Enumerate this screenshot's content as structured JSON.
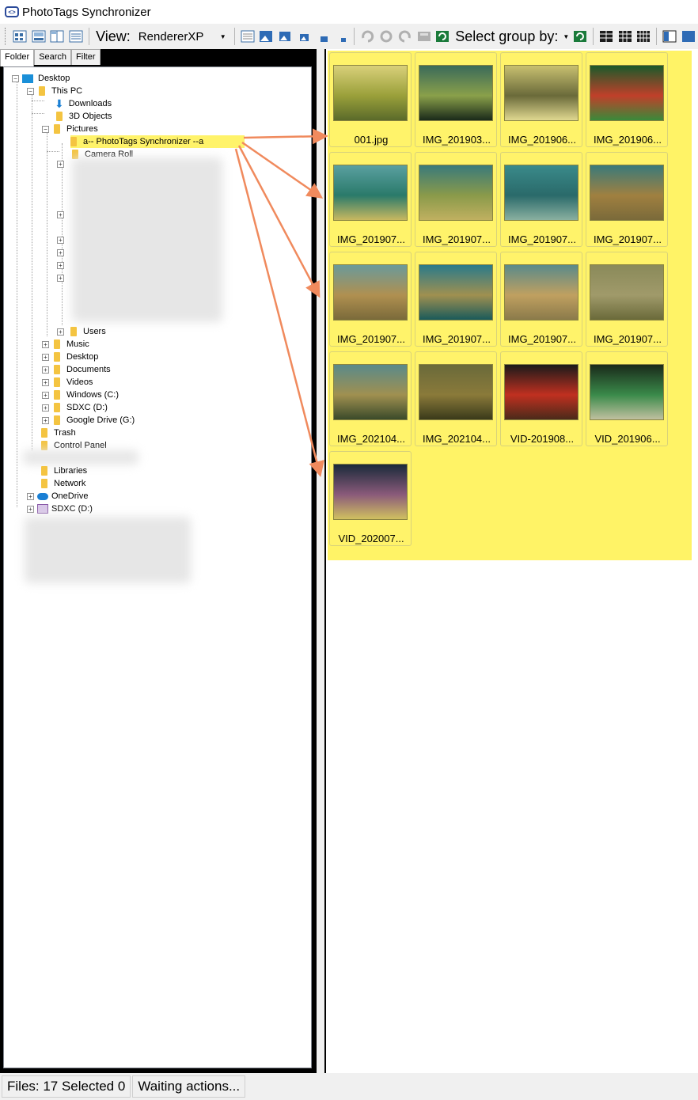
{
  "window": {
    "title": "PhotoTags Synchronizer"
  },
  "toolbar": {
    "view_label": "View:",
    "renderer": "RendererXP",
    "select_group_label": "Select group by:"
  },
  "left_tabs": [
    "Folder",
    "Search",
    "Filter"
  ],
  "tree": {
    "desktop": "Desktop",
    "this_pc": "This PC",
    "downloads": "Downloads",
    "objects3d": "3D Objects",
    "pictures": "Pictures",
    "selected_folder": "a-- PhotoTags Synchronizer --a",
    "camera_roll": "Camera Roll",
    "users": "Users",
    "music": "Music",
    "desktop2": "Desktop",
    "documents": "Documents",
    "videos": "Videos",
    "windows_c": "Windows (C:)",
    "sdxc_d": "SDXC (D:)",
    "google_drive": "Google Drive (G:)",
    "trash": "Trash",
    "control_panel": "Control Panel",
    "libraries": "Libraries",
    "network": "Network",
    "onedrive": "OneDrive",
    "sdxc_d2": "SDXC (D:)"
  },
  "thumbnails": [
    {
      "name": "001.jpg"
    },
    {
      "name": "IMG_201903..."
    },
    {
      "name": "IMG_201906..."
    },
    {
      "name": "IMG_201906..."
    },
    {
      "name": "IMG_201907..."
    },
    {
      "name": "IMG_201907..."
    },
    {
      "name": "IMG_201907..."
    },
    {
      "name": "IMG_201907..."
    },
    {
      "name": "IMG_201907..."
    },
    {
      "name": "IMG_201907..."
    },
    {
      "name": "IMG_201907..."
    },
    {
      "name": "IMG_201907..."
    },
    {
      "name": "IMG_202104..."
    },
    {
      "name": "IMG_202104..."
    },
    {
      "name": "VID-201908..."
    },
    {
      "name": "VID_201906..."
    },
    {
      "name": "VID_202007..."
    }
  ],
  "status": {
    "files": "Files: 17 Selected 0",
    "action": "Waiting actions..."
  },
  "colors": {
    "highlight": "#fff366",
    "arrow": "#f08a5d",
    "frame": "#000000"
  }
}
